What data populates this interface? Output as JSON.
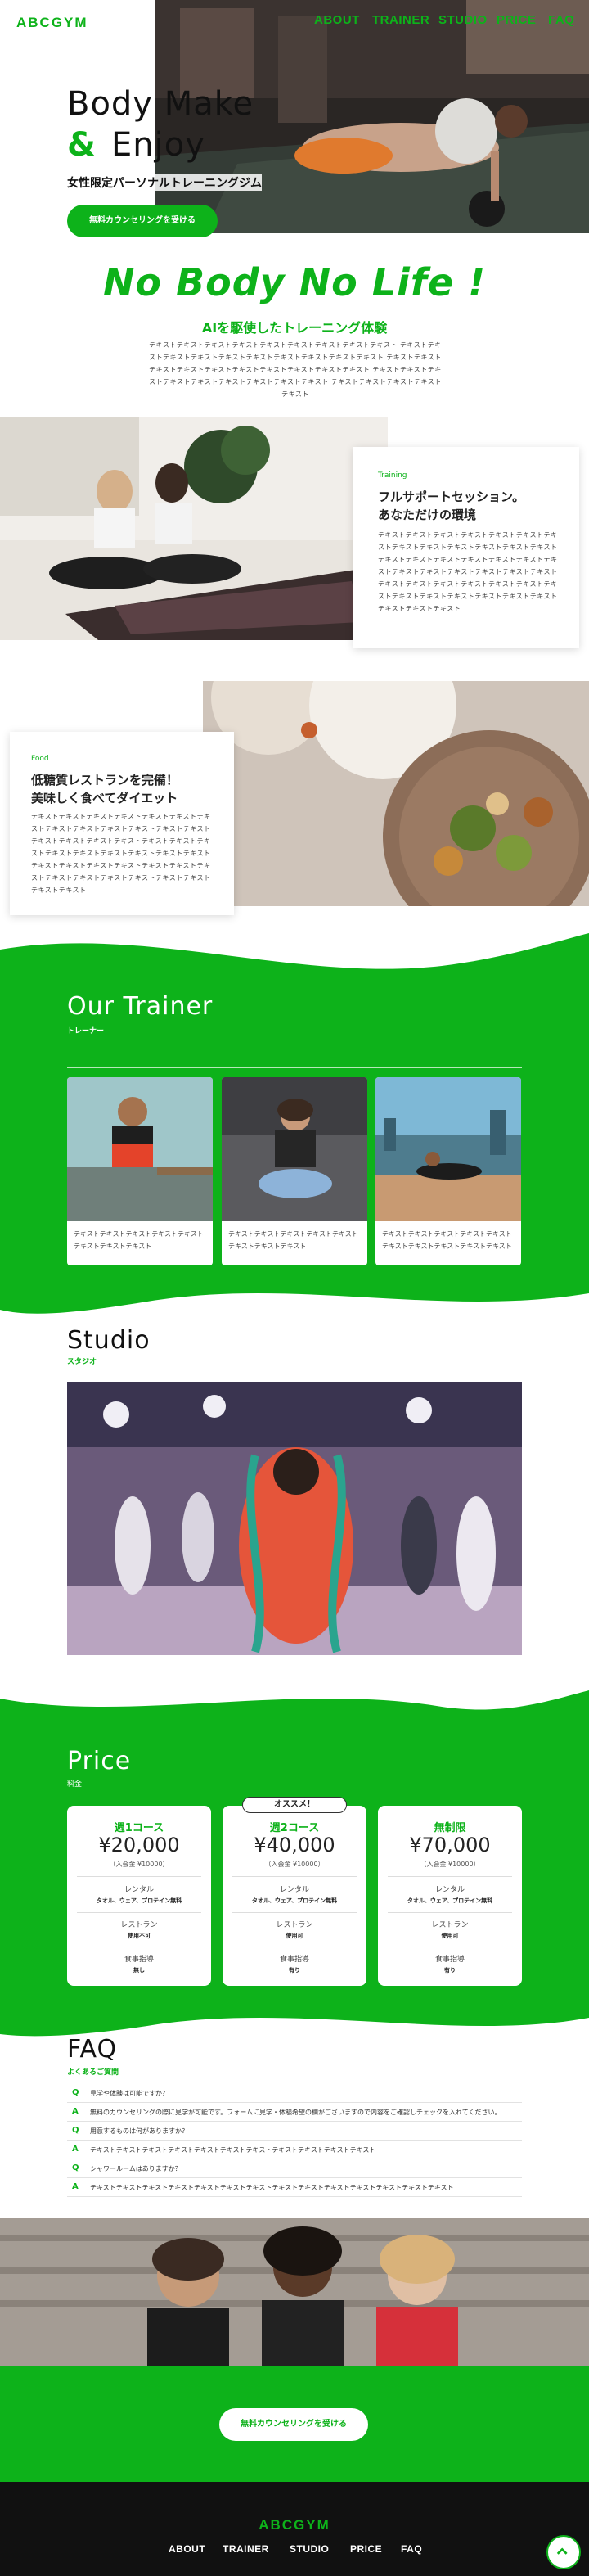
{
  "colors": {
    "brand_green": "#0db21a",
    "dark": "#111111",
    "white": "#ffffff"
  },
  "header": {
    "logo": "ABCGYM",
    "nav": [
      "ABOUT",
      "TRAINER",
      "STUDIO",
      "PRICE",
      "FAQ"
    ]
  },
  "hero": {
    "title_line1": "Body Make",
    "title_amp": "&",
    "title_line2": "Enjoy",
    "subtitle": "女性限定パーソナルトレーニングジム",
    "cta": "無料カウンセリングを受ける"
  },
  "about": {
    "slogan": "No Body No Life !",
    "heading": "AIを駆使したトレーニング体験",
    "body": "テキストテキストテキストテキストテキストテキストテキストテキストテキスト テキストテキストテキストテキストテキストテキストテキストテキストテキストテキスト テキストテキストテキストテキストテキストテキストテキストテキストテキストテキスト テキストテキストテキストテキストテキストテキストテキストテキストテキスト テキストテキストテキストテキストテキスト"
  },
  "training": {
    "label": "Training",
    "heading_line1": "フルサポートセッション。",
    "heading_line2": "あなただけの環境",
    "body": "テキストテキストテキストテキストテキストテキストテキストテキストテキストテキストテキストテキストテキストテキストテキストテキストテキストテキストテキストテキストテキストテキストテキストテキストテキストテキストテキストテキストテキストテキストテキストテキストテキストテキストテキストテキストテキストテキストテキストテキストテキストテキスト"
  },
  "food": {
    "label": "Food",
    "heading_line1": "低糖質レストランを完備！",
    "heading_line2": "美味しく食べてダイエット",
    "body": "テキストテキストテキストテキストテキストテキストテキストテキストテキストテキストテキストテキストテキストテキストテキストテキストテキストテキストテキストテキストテキストテキストテキストテキストテキストテキストテキストテキストテキストテキストテキストテキストテキストテキストテキストテキストテキストテキストテキストテキストテキスト"
  },
  "trainer": {
    "title": "Our Trainer",
    "sub": "トレーナー",
    "cards": [
      "テキストテキストテキストテキストテキストテキストテキストテキスト",
      "テキストテキストテキストテキストテキストテキストテキストテキスト",
      "テキストテキストテキストテキストテキストテキストテキストテキストテキストテキスト"
    ]
  },
  "studio": {
    "title": "Studio",
    "sub": "スタジオ"
  },
  "price": {
    "title": "Price",
    "sub": "料金",
    "badge": "オススメ！",
    "plans": [
      {
        "name": "週1コース",
        "price": "¥20,000",
        "fee": "（入会金 ¥10000）",
        "rental_label": "レンタル",
        "rental": "タオル、ウェア、プロテイン無料",
        "restaurant_label": "レストラン",
        "restaurant": "使用不可",
        "diet_label": "食事指導",
        "diet": "無し"
      },
      {
        "name": "週2コース",
        "price": "¥40,000",
        "fee": "（入会金 ¥10000）",
        "rental_label": "レンタル",
        "rental": "タオル、ウェア、プロテイン無料",
        "restaurant_label": "レストラン",
        "restaurant": "使用可",
        "diet_label": "食事指導",
        "diet": "有り"
      },
      {
        "name": "無制限",
        "price": "¥70,000",
        "fee": "（入会金 ¥10000）",
        "rental_label": "レンタル",
        "rental": "タオル、ウェア、プロテイン無料",
        "restaurant_label": "レストラン",
        "restaurant": "使用可",
        "diet_label": "食事指導",
        "diet": "有り"
      }
    ]
  },
  "faq": {
    "title": "FAQ",
    "sub": "よくあるご質問",
    "items": [
      {
        "mark": "Q",
        "text": "見学や体験は可能ですか？"
      },
      {
        "mark": "A",
        "text": "無料のカウンセリングの際に見学が可能です。フォームに見学・体験希望の欄がございますので内容をご確認しチェックを入れてください。"
      },
      {
        "mark": "Q",
        "text": "用意するものは何がありますか？"
      },
      {
        "mark": "A",
        "text": "テキストテキストテキストテキストテキストテキストテキストテキストテキストテキストテキスト"
      },
      {
        "mark": "Q",
        "text": "シャワールームはありますか？"
      },
      {
        "mark": "A",
        "text": "テキストテキストテキストテキストテキストテキストテキストテキストテキストテキストテキストテキストテキストテキスト"
      }
    ]
  },
  "cta_bottom": "無料カウンセリングを受ける",
  "footer": {
    "logo": "ABCGYM",
    "nav": [
      "ABOUT",
      "TRAINER",
      "STUDIO",
      "PRICE",
      "FAQ"
    ],
    "back_to_top_icon": "chevron-up-icon"
  }
}
